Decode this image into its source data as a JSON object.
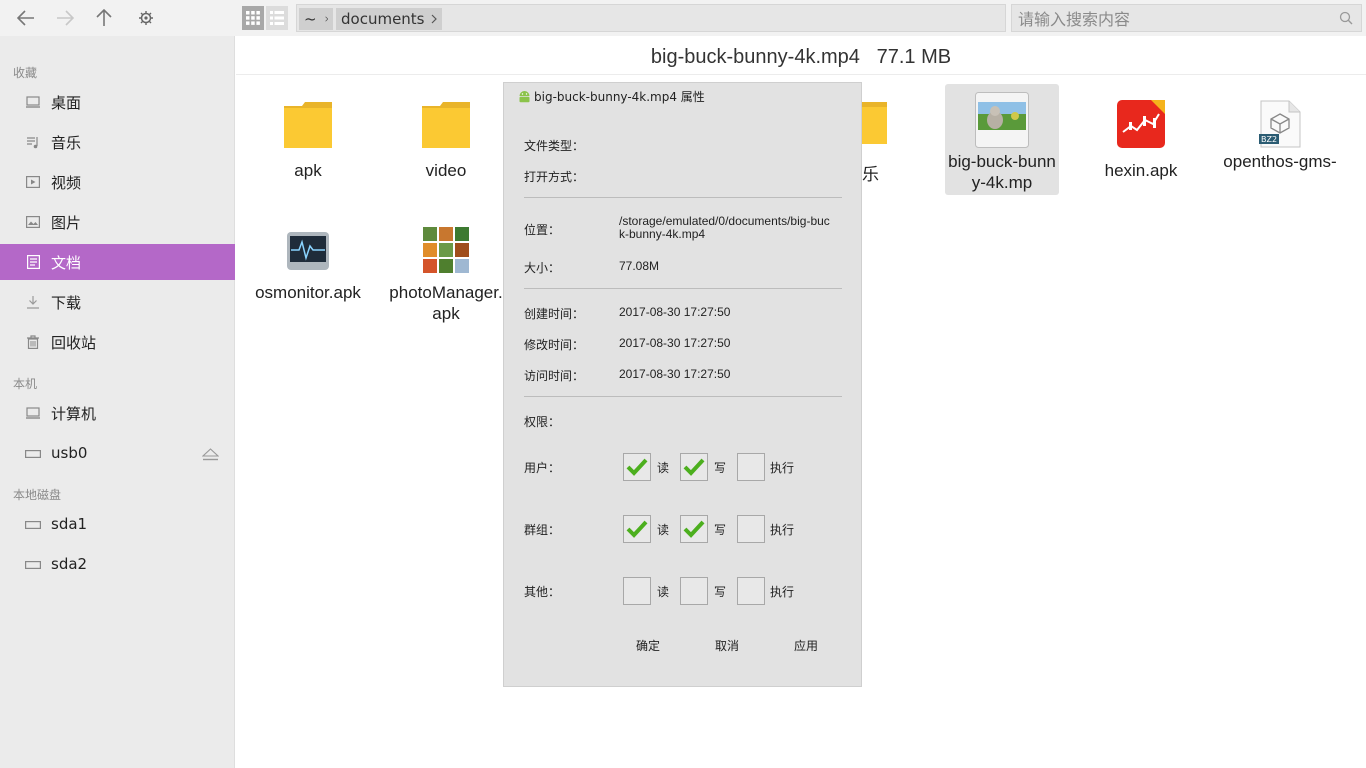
{
  "toolbar": {
    "icons": [
      "back-arrow-icon",
      "forward-arrow-icon",
      "up-arrow-icon",
      "gear-icon",
      "grid-view-icon",
      "list-view-icon"
    ],
    "breadcrumb_home": "~",
    "breadcrumb_current": "documents",
    "search_placeholder": "请输入搜索内容"
  },
  "sidebar": {
    "favorites_title": "收藏",
    "favorites": [
      {
        "label": "桌面",
        "icon": "desktop-icon"
      },
      {
        "label": "音乐",
        "icon": "music-icon"
      },
      {
        "label": "视频",
        "icon": "video-icon"
      },
      {
        "label": "图片",
        "icon": "picture-icon"
      },
      {
        "label": "文档",
        "icon": "document-icon",
        "selected": true
      },
      {
        "label": "下载",
        "icon": "download-icon"
      },
      {
        "label": "回收站",
        "icon": "trash-icon"
      }
    ],
    "local_title": "本机",
    "local": [
      {
        "label": "计算机",
        "icon": "computer-icon"
      },
      {
        "label": "usb0",
        "icon": "drive-icon"
      }
    ],
    "disks_title": "本地磁盘",
    "disks": [
      {
        "label": "sda1",
        "icon": "drive-icon"
      },
      {
        "label": "sda2",
        "icon": "drive-icon"
      }
    ]
  },
  "header": {
    "filename": "big-buck-bunny-4k.mp4",
    "size": "77.1 MB",
    "title": "big-buck-bunny-4k.mp4   77.1 MB"
  },
  "files": [
    {
      "name": "apk",
      "icon": "folder-icon"
    },
    {
      "name": "video",
      "icon": "folder-icon"
    },
    {
      "name": "乐",
      "icon": "folder-icon"
    },
    {
      "name": "big-buck-bunny-4k.mp",
      "icon": "video-thumbnail-icon",
      "selected": true
    },
    {
      "name": "hexin.apk",
      "icon": "stock-app-icon"
    },
    {
      "name": "openthos-gms-",
      "icon": "bz2-archive-icon"
    },
    {
      "name": "osmonitor.apk",
      "icon": "monitor-app-icon"
    },
    {
      "name": "photoManager.apk",
      "icon": "photo-app-icon"
    }
  ],
  "dialog": {
    "title": "big-buck-bunny-4k.mp4 属性",
    "file_type_label": "文件类型：",
    "file_type_value": "",
    "open_with_label": "打开方式：",
    "open_with_value": "",
    "location_label": "位置：",
    "location_value": "/storage/emulated/0/documents/big-buck-bunny-4k.mp4",
    "size_label": "大小：",
    "size_value": "77.08M",
    "created_label": "创建时间：",
    "created_value": "2017-08-30 17:27:50",
    "modified_label": "修改时间：",
    "modified_value": "2017-08-30 17:27:50",
    "accessed_label": "访问时间：",
    "accessed_value": "2017-08-30 17:27:50",
    "permissions_label": "权限：",
    "perm_read": "读",
    "perm_write": "写",
    "perm_exec": "执行",
    "permissions": [
      {
        "label": "用户：",
        "read": true,
        "write": true,
        "exec": false
      },
      {
        "label": "群组：",
        "read": true,
        "write": true,
        "exec": false
      },
      {
        "label": "其他：",
        "read": false,
        "write": false,
        "exec": false
      }
    ],
    "ok_label": "确定",
    "cancel_label": "取消",
    "apply_label": "应用"
  },
  "colors": {
    "accent": "#b468c8",
    "folder": "#fbc933",
    "check": "#4caf1e"
  }
}
